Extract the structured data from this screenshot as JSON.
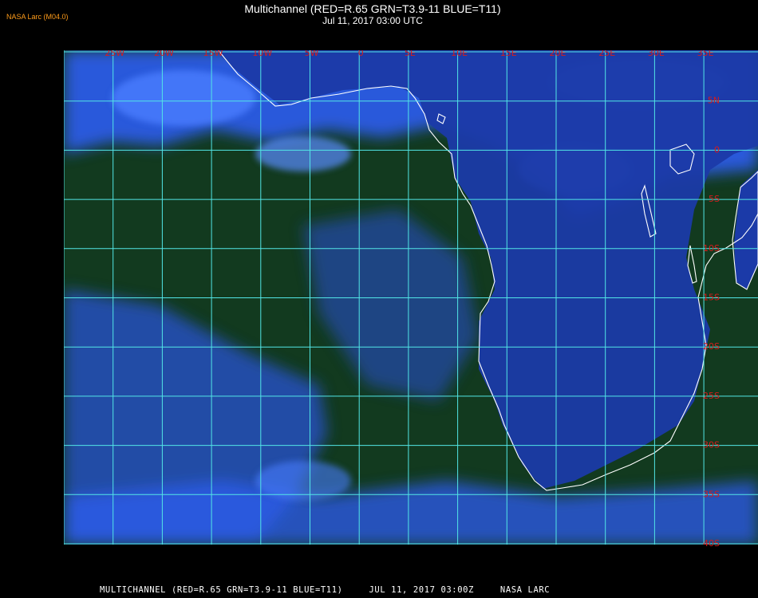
{
  "header": {
    "brand": "NASA Larc (M04.0)",
    "title": "Multichannel (RED=R.65 GRN=T3.9-11 BLUE=T11)",
    "subtitle": "Jul 11, 2017 03:00 UTC"
  },
  "map": {
    "longitude_labels": [
      {
        "lon": -25,
        "label": "25W"
      },
      {
        "lon": -20,
        "label": "20W"
      },
      {
        "lon": -15,
        "label": "15W"
      },
      {
        "lon": -10,
        "label": "10W"
      },
      {
        "lon": -5,
        "label": "5W"
      },
      {
        "lon": 0,
        "label": "0"
      },
      {
        "lon": 5,
        "label": "5E"
      },
      {
        "lon": 10,
        "label": "10E"
      },
      {
        "lon": 15,
        "label": "15E"
      },
      {
        "lon": 20,
        "label": "20E"
      },
      {
        "lon": 25,
        "label": "25E"
      },
      {
        "lon": 30,
        "label": "30E"
      },
      {
        "lon": 35,
        "label": "35E"
      }
    ],
    "latitude_labels": [
      {
        "lat": 5,
        "label": "5N"
      },
      {
        "lat": 0,
        "label": "0"
      },
      {
        "lat": -5,
        "label": "5S"
      },
      {
        "lat": -10,
        "label": "10S"
      },
      {
        "lat": -15,
        "label": "15S"
      },
      {
        "lat": -20,
        "label": "20S"
      },
      {
        "lat": -25,
        "label": "25S"
      },
      {
        "lat": -30,
        "label": "30S"
      },
      {
        "lat": -35,
        "label": "35S"
      },
      {
        "lat": -40,
        "label": "40S"
      }
    ],
    "lon_range": [
      -30,
      35
    ],
    "lat_range": [
      -40,
      10
    ],
    "grid_lon_step": 5,
    "grid_lat_step": 5,
    "colors": {
      "grid": "#52e6e6",
      "coastline": "#ffffff",
      "label": "#d61c1c",
      "ocean": "#123a1f",
      "cloud": "#2f5cf0",
      "land": "#1b3aa8",
      "brand": "#ff9c1a"
    }
  },
  "footer": {
    "product": "MULTICHANNEL (RED=R.65 GRN=T3.9-11 BLUE=T11)",
    "datetime": "JUL 11, 2017 03:00Z",
    "credit": "NASA LARC"
  }
}
